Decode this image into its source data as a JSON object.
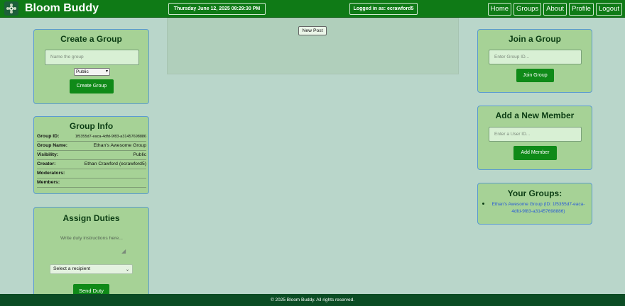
{
  "header": {
    "brand": "Bloom Buddy",
    "datetime": "Thursday June 12, 2025  08:29:30 PM",
    "login_status": "Logged in as: ecrawford5",
    "nav": [
      "Home",
      "Groups",
      "About",
      "Profile",
      "Logout"
    ]
  },
  "create_group": {
    "title": "Create a Group",
    "name_placeholder": "Name the group",
    "visibility_selected": "Public",
    "button": "Create Group"
  },
  "group_info": {
    "title": "Group Info",
    "rows": [
      {
        "label": "Group ID:",
        "value": "1f5355d7-eaca-4dfd-9f83-a31457698886"
      },
      {
        "label": "Group Name:",
        "value": "Ethan's Awesome Group"
      },
      {
        "label": "Visibility:",
        "value": "Public"
      },
      {
        "label": "Creator:",
        "value": "Ethan Crawford (ecrawford5)"
      },
      {
        "label": "Moderators:",
        "value": ""
      },
      {
        "label": "Members:",
        "value": ""
      }
    ]
  },
  "assign_duties": {
    "title": "Assign Duties",
    "instructions_placeholder": "Write duty instructions here...",
    "recipient_selected": "Select a recipient",
    "button": "Send Duty"
  },
  "feed": {
    "new_post_button": "New Post"
  },
  "join_group": {
    "title": "Join a Group",
    "input_placeholder": "Enter Group ID...",
    "button": "Join Group"
  },
  "add_member": {
    "title": "Add a New Member",
    "input_placeholder": "Enter a User ID...",
    "button": "Add Member"
  },
  "your_groups": {
    "title": "Your Groups:",
    "items": [
      "Ethan's Awesome Group (ID: 1f5355d7-eaca-4dfd-9f83-a31457698886)"
    ]
  },
  "footer": {
    "text": "© 2025 Bloom Buddy. All rights reserved."
  },
  "colors": {
    "header_green": "#0f7a16",
    "panel_green": "#a6d296",
    "page_bg": "#b9d6ca",
    "button_green": "#0f8a18",
    "footer_green": "#0b4c24",
    "link_blue": "#2a5bd7"
  }
}
